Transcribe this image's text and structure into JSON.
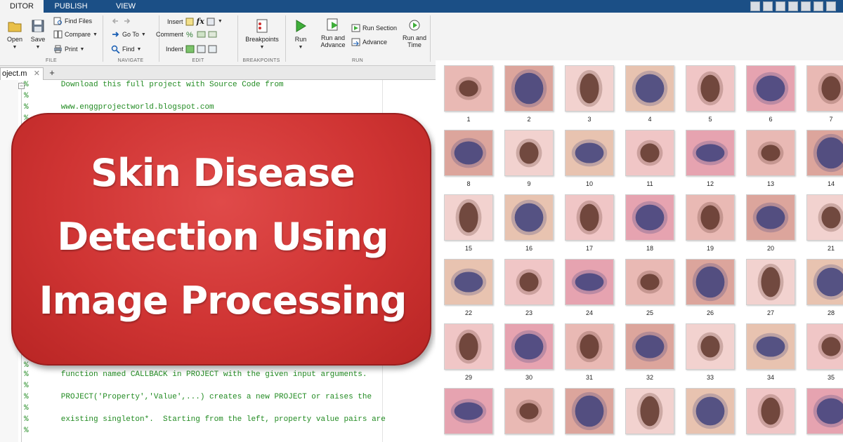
{
  "tabs": [
    "DITOR",
    "PUBLISH",
    "VIEW"
  ],
  "ribbon": {
    "file": {
      "open": "Open",
      "save": "Save",
      "find_files": "Find Files",
      "compare": "Compare",
      "print": "Print",
      "section": "FILE"
    },
    "navigate": {
      "goto": "Go To",
      "find": "Find",
      "section": "NAVIGATE"
    },
    "edit": {
      "insert": "Insert",
      "comment": "Comment",
      "indent": "Indent",
      "fx": "fx",
      "section": "EDIT"
    },
    "breakpoints": {
      "label": "Breakpoints",
      "section": "BREAKPOINTS"
    },
    "run": {
      "run": "Run",
      "run_advance_1": "Run and",
      "run_advance_2": "Advance",
      "run_section": "Run Section",
      "advance": "Advance",
      "run_time_1": "Run and",
      "run_time_2": "Time",
      "section": "RUN"
    }
  },
  "editor": {
    "doc_tab": "oject.m",
    "close_glyph": "✕",
    "add_glyph": "+",
    "code_lines": [
      "%       Download this full project with Source Code from",
      "%",
      "%       www.enggprojectworld.blogspot.com",
      "%",
      "%",
      "%",
      "%       function named CALLBACK in PROJECT with the given input arguments.",
      "%",
      "%       PROJECT('Property','Value',...) creates a new PROJECT or raises the",
      "%",
      "%       existing singleton*.  Starting from the left, property value pairs are",
      "%"
    ]
  },
  "banner": {
    "lines": [
      "Skin Disease",
      "Detection Using",
      "Image Processing"
    ]
  },
  "gallery": {
    "labels": [
      "1",
      "2",
      "3",
      "4",
      "5",
      "6",
      "7",
      "8",
      "9",
      "10",
      "11",
      "12",
      "13",
      "14",
      "15",
      "16",
      "17",
      "18",
      "19",
      "20",
      "21",
      "22",
      "23",
      "24",
      "25",
      "26",
      "27",
      "28",
      "29",
      "30",
      "31",
      "32",
      "33",
      "34",
      "35"
    ],
    "colors": {
      "skin_light": "#e9b9b4",
      "skin_pink": "#e6a3b0",
      "lesion_dark": "#5a3125",
      "lesion_brown": "#8a5a3f",
      "lesion_red": "#b3283e",
      "lesion_blue": "#3b3f7a"
    }
  },
  "colors": {
    "banner_red": "#cf3433",
    "code_green": "#228b22",
    "tab_bar": "#1b4f86"
  }
}
